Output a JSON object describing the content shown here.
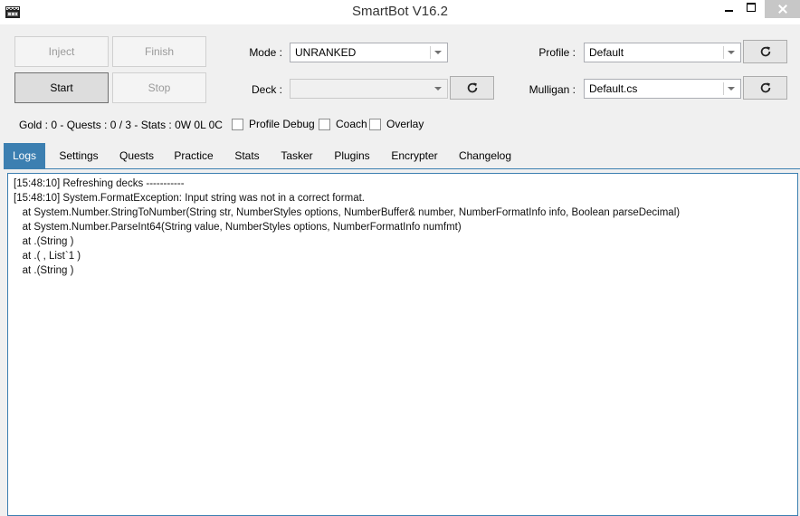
{
  "window": {
    "title": "SmartBot V16.2"
  },
  "buttons": {
    "inject": "Inject",
    "finish": "Finish",
    "start": "Start",
    "stop": "Stop"
  },
  "mode": {
    "label": "Mode :",
    "value": "UNRANKED"
  },
  "deck": {
    "label": "Deck :",
    "value": ""
  },
  "profile": {
    "label": "Profile :",
    "value": "Default"
  },
  "mulligan": {
    "label": "Mulligan :",
    "value": "Default.cs"
  },
  "status": {
    "stats_text": "Gold : 0 - Quests : 0 / 3 - Stats : 0W 0L 0C"
  },
  "checkboxes": {
    "profile_debug": "Profile Debug",
    "coach": "Coach",
    "overlay": "Overlay"
  },
  "tabs": [
    "Logs",
    "Settings",
    "Quests",
    "Practice",
    "Stats",
    "Tasker",
    "Plugins",
    "Encrypter",
    "Changelog"
  ],
  "log_lines": [
    "[15:48:10] Refreshing decks -----------",
    "[15:48:10] System.FormatException: Input string was not in a correct format.",
    "   at System.Number.StringToNumber(String str, NumberStyles options, NumberBuffer& number, NumberFormatInfo info, Boolean parseDecimal)",
    "   at System.Number.ParseInt64(String value, NumberStyles options, NumberFormatInfo numfmt)",
    "   at .(String )",
    "   at .( , List`1 )",
    "   at .(String )"
  ],
  "colors": {
    "accent": "#3c7fb1",
    "close_button": "#c7c7c7"
  },
  "icons": {
    "refresh": "refresh-icon",
    "app": "smartbot-app-icon"
  }
}
